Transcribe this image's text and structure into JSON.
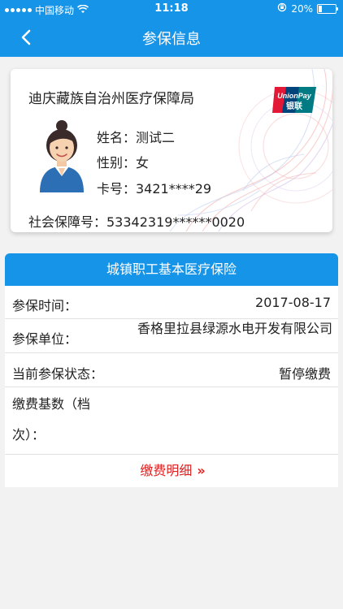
{
  "status": {
    "carrier": "中国移动",
    "time": "11:18",
    "battery": "20%",
    "battery_level": 0.2
  },
  "nav": {
    "title": "参保信息"
  },
  "card": {
    "org": "迪庆藏族自治州医疗保障局",
    "name_line": "姓名：测试二",
    "gender_line": "性别：女",
    "cardno_line": "卡号：3421****29",
    "ssn_line": "社会保障号：53342319******0020",
    "unionpay_text": "UnionPay",
    "unionpay_cn": "银联"
  },
  "panel": {
    "header": "城镇职工基本医疗保险",
    "rows": [
      {
        "label": "参保时间：",
        "value": "2017-08-17"
      },
      {
        "label": "参保单位：",
        "value": "香格里拉县绿源水电开发有限公司"
      },
      {
        "label": "当前参保状态：",
        "value": "暂停缴费"
      },
      {
        "label": "缴费基数（档次）：",
        "value": ""
      }
    ],
    "detail_label": "缴费明细",
    "detail_arrows": "»"
  },
  "colors": {
    "brand_blue": "#1694e8",
    "detail_red": "#e02020"
  },
  "icons": {
    "back": "chevron-left-icon",
    "wifi": "wifi-icon",
    "battery": "battery-icon",
    "lock": "orientation-lock-icon"
  }
}
